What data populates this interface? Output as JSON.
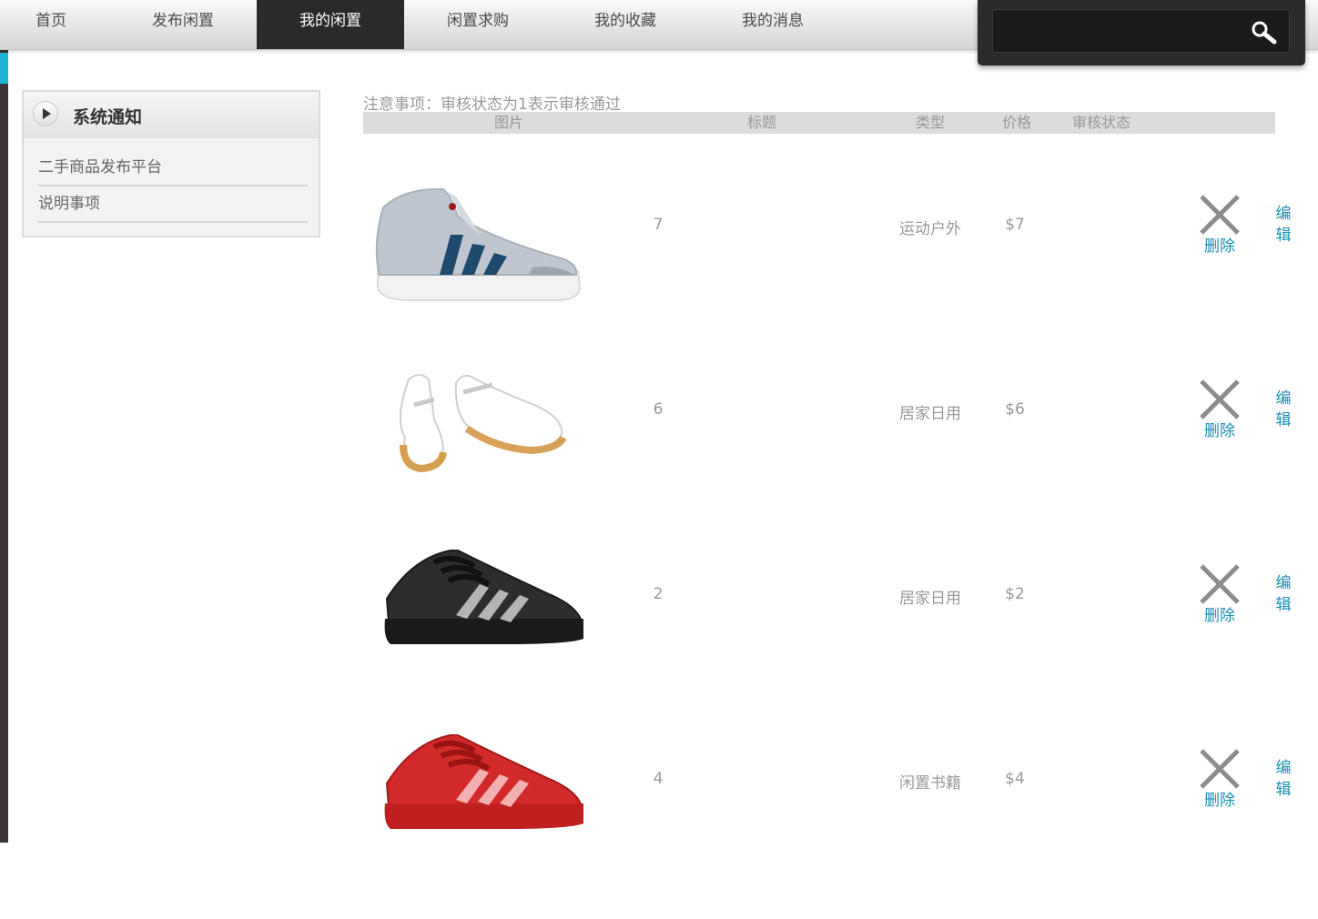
{
  "nav": {
    "items": [
      {
        "label": "首页"
      },
      {
        "label": "发布闲置"
      },
      {
        "label": "我的闲置"
      },
      {
        "label": "闲置求购"
      },
      {
        "label": "我的收藏"
      },
      {
        "label": "我的消息"
      }
    ],
    "active_index": 2,
    "search": {
      "placeholder": "",
      "value": ""
    }
  },
  "sidebar": {
    "title": "系统通知",
    "items": [
      {
        "label": "二手商品发布平台"
      },
      {
        "label": "说明事项"
      }
    ]
  },
  "notice": "注意事项：审核状态为1表示审核通过",
  "table": {
    "headers": {
      "image": "图片",
      "title": "标题",
      "type": "类型",
      "price": "价格",
      "status": "审核状态"
    },
    "rows": [
      {
        "title": "7",
        "type": "运动户外",
        "price": "$7",
        "status": "",
        "shoe": "grey-hightop-sneaker",
        "delete_label": "删除",
        "edit_label": "编辑"
      },
      {
        "title": "6",
        "type": "居家日用",
        "price": "$6",
        "status": "",
        "shoe": "white-mary-jane-shoes",
        "delete_label": "删除",
        "edit_label": "编辑"
      },
      {
        "title": "2",
        "type": "居家日用",
        "price": "$2",
        "status": "",
        "shoe": "black-striped-sneaker",
        "delete_label": "删除",
        "edit_label": "编辑"
      },
      {
        "title": "4",
        "type": "闲置书籍",
        "price": "$4",
        "status": "",
        "shoe": "red-striped-sneaker",
        "delete_label": "删除",
        "edit_label": "编辑"
      }
    ]
  },
  "colors": {
    "nav_active_bg": "#2a2a2a",
    "link": "#1a8fb0",
    "muted_text": "#999999",
    "accent_strip": "#1ab3d6"
  }
}
